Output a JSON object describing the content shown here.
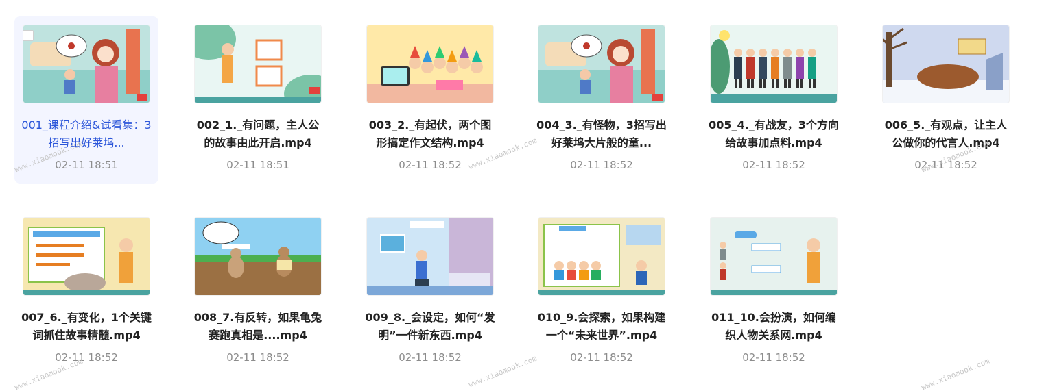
{
  "watermark": "www.xiaomook.com",
  "files": [
    {
      "title": "001_课程介绍&试看集：3招写出好莱坞...",
      "date": "02-11 18:51",
      "selected": true,
      "scene": "girl-bench"
    },
    {
      "title": "002_1._有问题，主人公的故事由此开启.mp4",
      "date": "02-11 18:51",
      "scene": "teacher-boards"
    },
    {
      "title": "003_2._有起伏，两个图形搞定作文结构.mp4",
      "date": "02-11 18:52",
      "scene": "party"
    },
    {
      "title": "004_3._有怪物，3招写出好莱坞大片般的童...",
      "date": "02-11 18:52",
      "scene": "girl-bench"
    },
    {
      "title": "005_4._有战友，3个方向给故事加点料.mp4",
      "date": "02-11 18:52",
      "scene": "people-row"
    },
    {
      "title": "006_5._有观点，让主人公做你的代言人.mp4",
      "date": "02-11 18:52",
      "scene": "winter"
    },
    {
      "title": "007_6._有变化，1个关键词抓住故事精髓.mp4",
      "date": "02-11 18:52",
      "scene": "teacher-board"
    },
    {
      "title": "008_7.有反转，如果龟兔赛跑真相是....mp4",
      "date": "02-11 18:52",
      "scene": "race"
    },
    {
      "title": "009_8._会设定，如何“发明”一件新东西.mp4",
      "date": "02-11 18:52",
      "scene": "room"
    },
    {
      "title": "010_9.会探索，如果构建一个“未来世界”.mp4",
      "date": "02-11 18:52",
      "scene": "kids-board"
    },
    {
      "title": "011_10.会扮演，如何编织人物关系网.mp4",
      "date": "02-11 18:52",
      "scene": "teacher-chart"
    }
  ]
}
